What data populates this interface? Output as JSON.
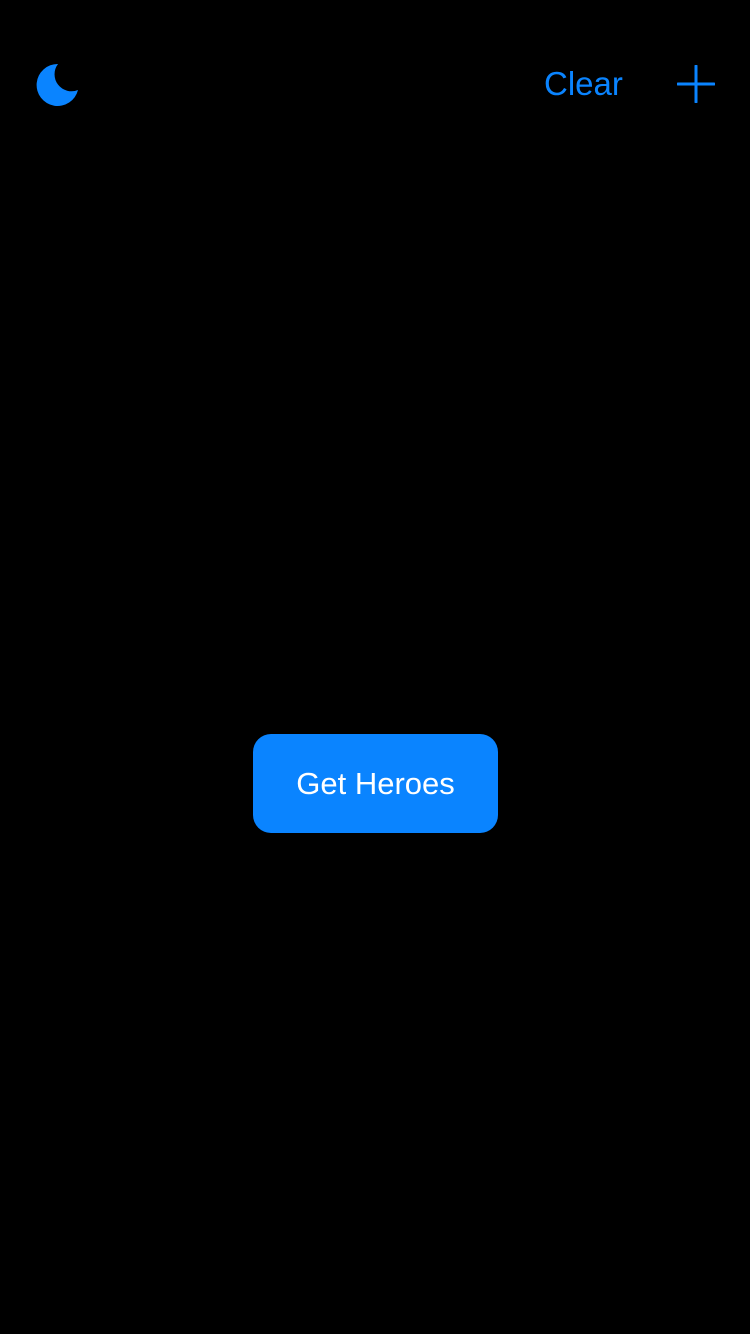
{
  "theme": {
    "background": "#000000",
    "accent": "#0a84ff",
    "button_text": "#ffffff"
  },
  "nav": {
    "left_icon": "moon-icon",
    "clear_label": "Clear",
    "right_icon": "plus-icon"
  },
  "main": {
    "get_heroes_label": "Get Heroes"
  }
}
